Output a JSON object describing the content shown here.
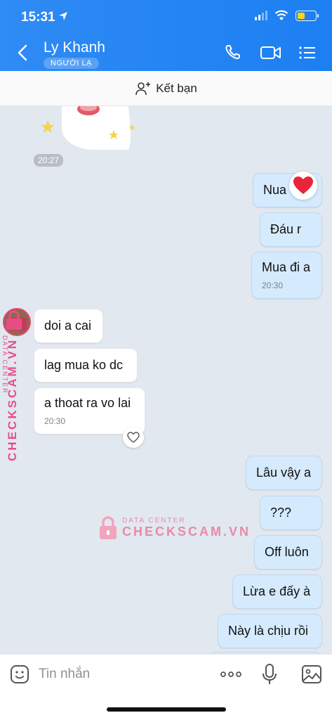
{
  "status_bar": {
    "time": "15:31",
    "location_icon": "location-arrow-icon",
    "battery_color": "#ffd60a"
  },
  "header": {
    "back_icon": "chevron-left-icon",
    "contact_name": "Ly Khanh",
    "badge": "NGƯỜI LẠ",
    "actions": [
      "phone-icon",
      "video-camera-icon",
      "list-menu-icon"
    ]
  },
  "add_friend": {
    "label": "Kết bạn",
    "icon": "add-person-icon"
  },
  "chat": {
    "sticker_time": "20:27",
    "messages": [
      {
        "from": "me",
        "text": "Nua",
        "reaction": "heart-icon"
      },
      {
        "from": "me",
        "text": "Đáu r"
      },
      {
        "from": "me",
        "text": "Mua đi a",
        "time": "20:30"
      },
      {
        "from": "them",
        "text": "doi a cai"
      },
      {
        "from": "them",
        "text": "lag mua ko dc"
      },
      {
        "from": "them",
        "text": "a thoat ra vo lai",
        "time": "20:30"
      },
      {
        "from": "me",
        "text": "Lâu vậy a"
      },
      {
        "from": "me",
        "text": "???"
      },
      {
        "from": "me",
        "text": "Off luôn"
      },
      {
        "from": "me",
        "text": "Lừa e đấy à"
      },
      {
        "from": "me",
        "text": "Này là chịu rồi"
      }
    ]
  },
  "watermark": {
    "small": "DATA CENTER",
    "big": "CHECKSCAM.VN"
  },
  "input": {
    "placeholder": "Tin nhắn",
    "icons": [
      "emoji-icon",
      "more-icon",
      "microphone-icon",
      "image-icon"
    ]
  },
  "colors": {
    "header": "#1c7ff2",
    "my_bubble": "#d5eafd",
    "background": "#e2e8ef"
  }
}
